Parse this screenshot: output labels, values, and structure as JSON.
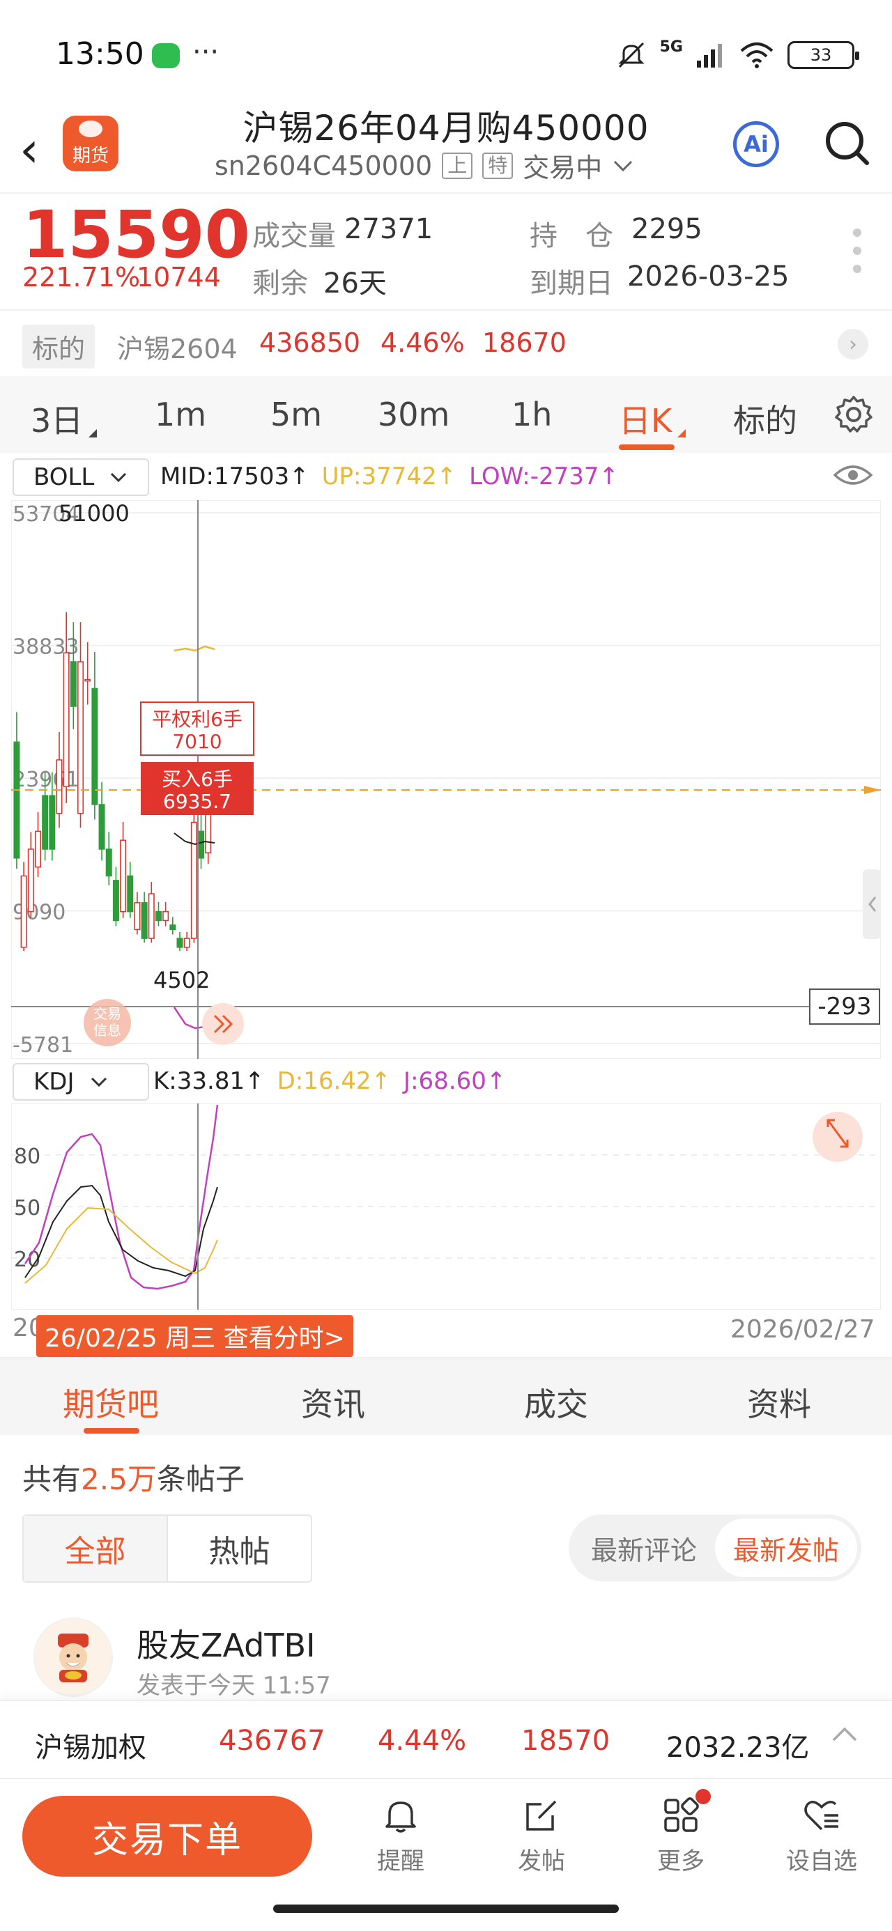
{
  "status": {
    "time": "13:50",
    "dots": "···",
    "net": "5G",
    "battery": "33"
  },
  "header": {
    "logo": "期货",
    "title": "沪锡26年04月购450000",
    "code": "sn2604C450000",
    "tag1": "上",
    "tag2": "特",
    "state": "交易中",
    "ai": "Ai"
  },
  "quote": {
    "price": "15590",
    "pct": "221.71%",
    "chg": "10744",
    "volume_label": "成交量",
    "volume": "27371",
    "oi_label": "持　仓",
    "oi": "2295",
    "remain_label": "剩余",
    "remain": "26天",
    "expiry_label": "到期日",
    "expiry": "2026-03-25"
  },
  "underlying": {
    "tag": "标的",
    "name": "沪锡2604",
    "price": "436850",
    "pct": "4.46%",
    "chg": "18670"
  },
  "period_tabs": [
    "3日",
    "1m",
    "5m",
    "30m",
    "1h",
    "日K",
    "标的"
  ],
  "boll": {
    "name": "BOLL",
    "mid": "MID:17503↑",
    "up": "UP:37742↑",
    "low": "LOW:-2737↑"
  },
  "kdj": {
    "name": "KDJ",
    "k": "K:33.81↑",
    "d": "D:16.42↑",
    "j": "J:68.60↑"
  },
  "chart": {
    "y_ticks": [
      "53704",
      "38833",
      "23961",
      "9090",
      "-5781"
    ],
    "high_label": "51000",
    "low_label": "4502",
    "current_label": "-293",
    "close_pos_label": "平权利6手",
    "close_pos_value": "7010",
    "buy_label": "买入6手",
    "buy_value": "6935.7",
    "trade_info": "交易信息",
    "kdj_ticks": [
      "80",
      "50",
      "20"
    ]
  },
  "chart_data": {
    "type": "candlestick",
    "ylim": [
      -5781,
      53704
    ],
    "candles": [
      {
        "o": 28000,
        "c": 15000
      },
      {
        "o": 5000,
        "c": 13000
      },
      {
        "o": 9000,
        "c": 16000
      },
      {
        "o": 14000,
        "c": 18000
      },
      {
        "o": 22000,
        "c": 16000
      },
      {
        "o": 22000,
        "c": 16000
      },
      {
        "o": 20000,
        "c": 26000
      },
      {
        "o": 23000,
        "c": 38000
      },
      {
        "o": 37000,
        "c": 32000
      },
      {
        "o": 20000,
        "c": 37000
      },
      {
        "o": 35000,
        "c": 35000
      },
      {
        "o": 34000,
        "c": 21000
      },
      {
        "o": 21000,
        "c": 16000
      },
      {
        "o": 16000,
        "c": 13000
      },
      {
        "o": 12500,
        "c": 8000
      },
      {
        "o": 9000,
        "c": 17000
      },
      {
        "o": 13000,
        "c": 9000
      },
      {
        "o": 7000,
        "c": 10000
      },
      {
        "o": 10000,
        "c": 6000
      },
      {
        "o": 6000,
        "c": 11000
      },
      {
        "o": 9000,
        "c": 8000
      },
      {
        "o": 8000,
        "c": 9000
      },
      {
        "o": 7500,
        "c": 7000
      },
      {
        "o": 6000,
        "c": 5000
      },
      {
        "o": 5000,
        "c": 6000
      },
      {
        "o": 6000,
        "c": 19000
      },
      {
        "o": 18000,
        "c": 15000
      },
      {
        "o": 15590,
        "c": 20000
      }
    ]
  },
  "dates": {
    "left": "20",
    "selected": "26/02/25 周三 查看分时>",
    "right": "2026/02/27"
  },
  "content_tabs": [
    "期货吧",
    "资讯",
    "成交",
    "资料"
  ],
  "posts": {
    "prefix": "共有",
    "count": "2.5万",
    "suffix": "条帖子"
  },
  "filters": [
    "全部",
    "热帖"
  ],
  "sort": [
    "最新评论",
    "最新发帖"
  ],
  "post": {
    "user": "股友ZAdTBI",
    "time": "发表于今天 11:57"
  },
  "ticker": {
    "name": "沪锡加权",
    "price": "436767",
    "pct": "4.44%",
    "chg": "18570",
    "amount": "2032.23亿"
  },
  "bottom_nav": {
    "order": "交易下单",
    "remind": "提醒",
    "post": "发帖",
    "more": "更多",
    "watch": "设自选"
  },
  "colors": {
    "up": "#e0342c",
    "down": "#2e9c3a",
    "accent": "#ef5a2c",
    "upper_band": "#e8b83a",
    "lower_band": "#c040c0"
  }
}
